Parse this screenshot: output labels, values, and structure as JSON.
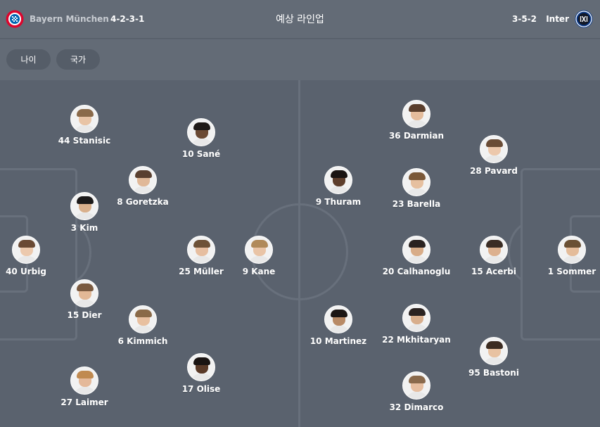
{
  "header": {
    "home_team": "Bayern München",
    "home_formation": "4-2-3-1",
    "title": "예상 라인업",
    "away_formation": "3-5-2",
    "away_team": "Inter"
  },
  "filters": [
    {
      "label": "나이"
    },
    {
      "label": "국가"
    }
  ],
  "colors": {
    "background": "#5c6470",
    "header": "#636b76",
    "pitch": "#5a626e",
    "pitch_lines": "#68707c",
    "bayern_red": "#dc052d",
    "inter_blue": "#0a3a8a"
  },
  "home_players": [
    {
      "label": "44 Stanisic",
      "skin": "#e8c4a6",
      "hair": "#8a6a4a",
      "kit": "#e8e8e8"
    },
    {
      "label": "10 Sané",
      "skin": "#6b4a34",
      "hair": "#1f1a18",
      "kit": "#e8e8e8"
    },
    {
      "label": "8 Goretzka",
      "skin": "#e0b898",
      "hair": "#5a4030",
      "kit": "#e8e8e8"
    },
    {
      "label": "3 Kim",
      "skin": "#d9b08c",
      "hair": "#1c1a1a",
      "kit": "#e8e8e8"
    },
    {
      "label": "40 Urbig",
      "skin": "#ecc9ad",
      "hair": "#6a4a34",
      "kit": "#e8e8e8"
    },
    {
      "label": "25 Müller",
      "skin": "#e6bea0",
      "hair": "#6e5238",
      "kit": "#e8e8e8"
    },
    {
      "label": "9 Kane",
      "skin": "#e9c4a6",
      "hair": "#b08a5a",
      "kit": "#e8e8e8"
    },
    {
      "label": "15 Dier",
      "skin": "#e2b896",
      "hair": "#7a5a40",
      "kit": "#e8e8e8"
    },
    {
      "label": "6 Kimmich",
      "skin": "#e8c0a0",
      "hair": "#8a6a48",
      "kit": "#e8e8e8"
    },
    {
      "label": "27 Laimer",
      "skin": "#e4b99a",
      "hair": "#c08a50",
      "kit": "#e8e8e8"
    },
    {
      "label": "17 Olise",
      "skin": "#5a3a28",
      "hair": "#1a1412",
      "kit": "#e8e8e8"
    }
  ],
  "away_players": [
    {
      "label": "36 Darmian",
      "skin": "#e4bc9c",
      "hair": "#5a3e2c",
      "kit": "#e8e8e8"
    },
    {
      "label": "28 Pavard",
      "skin": "#ecc8ac",
      "hair": "#6a4c36",
      "kit": "#e8e8e8"
    },
    {
      "label": "9 Thuram",
      "skin": "#5e3e2c",
      "hair": "#1a1412",
      "kit": "#e8e8e8"
    },
    {
      "label": "23 Barella",
      "skin": "#e6c0a0",
      "hair": "#7a5838",
      "kit": "#e8e8e8"
    },
    {
      "label": "20 Calhanoglu",
      "skin": "#d8ac88",
      "hair": "#2a2220",
      "kit": "#e8e8e8"
    },
    {
      "label": "15 Acerbi",
      "skin": "#dcb08e",
      "hair": "#3a2c24",
      "kit": "#e8e8e8"
    },
    {
      "label": "1 Sommer",
      "skin": "#e4bc9a",
      "hair": "#6a5034",
      "kit": "#e8e8e8"
    },
    {
      "label": "10 Martinez",
      "skin": "#b88a66",
      "hair": "#1c1614",
      "kit": "#e8e8e8"
    },
    {
      "label": "22 Mkhitaryan",
      "skin": "#d8ae8c",
      "hair": "#2a2220",
      "kit": "#e8e8e8"
    },
    {
      "label": "95 Bastoni",
      "skin": "#e8c2a2",
      "hair": "#3c2c22",
      "kit": "#e8e8e8"
    },
    {
      "label": "32 Dimarco",
      "skin": "#e6bea0",
      "hair": "#8a6a4c",
      "kit": "#e8e8e8"
    }
  ]
}
